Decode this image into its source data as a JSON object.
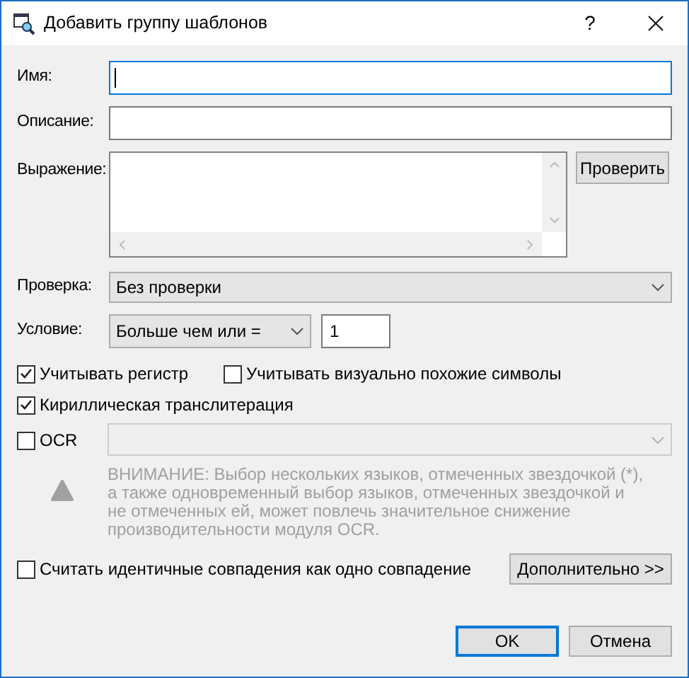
{
  "window": {
    "title": "Добавить группу шаблонов",
    "help": "?"
  },
  "name": {
    "label": "Имя:",
    "focused": true
  },
  "description": {
    "label": "Описание:"
  },
  "expression": {
    "label": "Выражение:",
    "check_button": "Проверить"
  },
  "validation": {
    "label": "Проверка:",
    "value": "Без проверки"
  },
  "condition": {
    "label": "Условие:",
    "value": "Больше чем или =",
    "count": "1"
  },
  "options": [
    {
      "label": "Учитывать регистр",
      "checked": true
    },
    {
      "label": "Учитывать визуально похожие символы",
      "checked": false
    },
    {
      "label": "Кириллическая транслитерация",
      "checked": true
    }
  ],
  "ocr": {
    "label": "OCR",
    "checked": false,
    "warning": "ВНИМАНИЕ: Выбор нескольких языков, отмеченных звездочкой (*), а также одновременный выбор языков, отмеченных звездочкой и не отмеченных ей, может повлечь значительное снижение производительности модуля OCR."
  },
  "count_identical": {
    "label": "Считать идентичные совпадения как одно совпадение",
    "checked": false
  },
  "more_button": "Дополнительно >>",
  "buttons": [
    {
      "label": "OK",
      "default": true
    },
    {
      "label": "Отмена",
      "default": false
    }
  ]
}
